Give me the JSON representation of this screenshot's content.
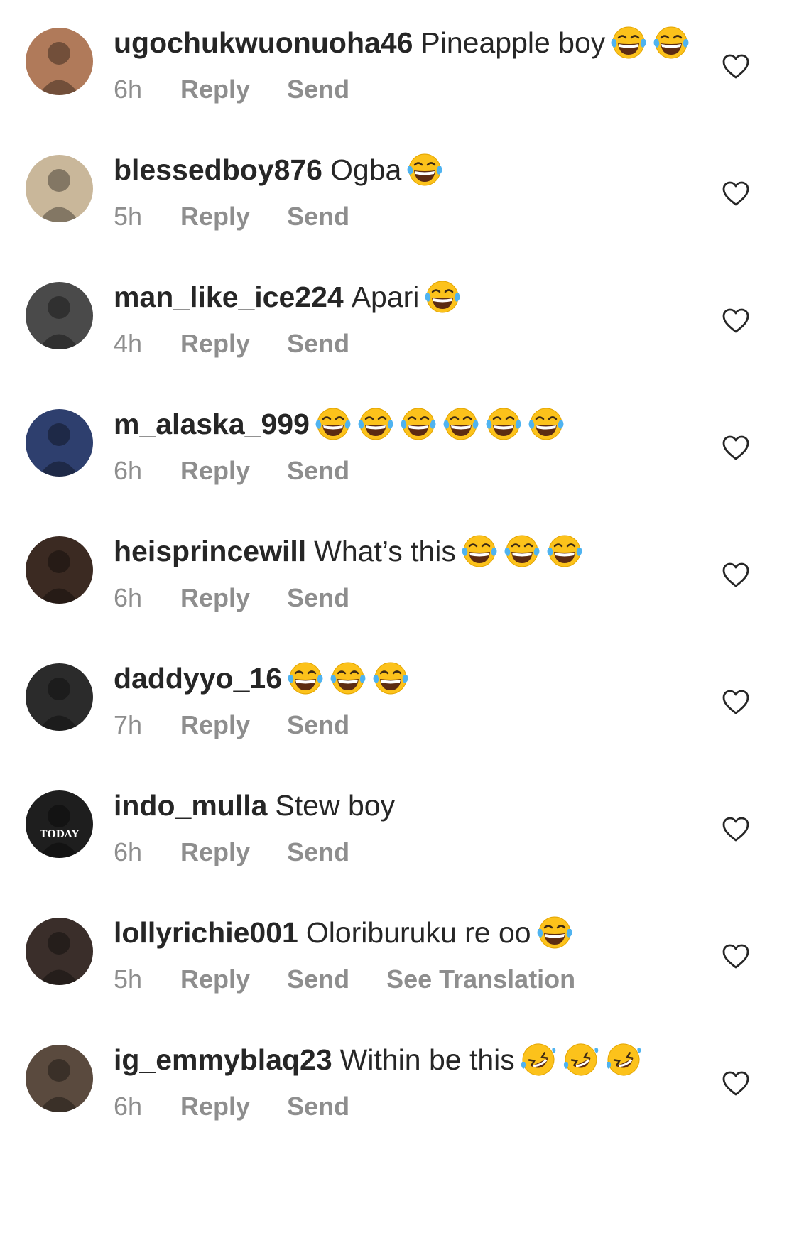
{
  "colors": {
    "text": "#262626",
    "meta": "#8e8e8e",
    "icon": "#262626"
  },
  "comments": [
    {
      "username": "ugochukwuonuoha46",
      "text": "Pineapple boy",
      "emojis": [
        "tears-of-joy",
        "tears-of-joy"
      ],
      "time": "6h",
      "reply": "Reply",
      "send": "Send",
      "translation": "",
      "avatar_color": "#b07a5a"
    },
    {
      "username": "blessedboy876",
      "text": "Ogba",
      "emojis": [
        "tears-of-joy"
      ],
      "time": "5h",
      "reply": "Reply",
      "send": "Send",
      "translation": "",
      "avatar_color": "#c9b79a"
    },
    {
      "username": "man_like_ice224",
      "text": "Apari",
      "emojis": [
        "tears-of-joy"
      ],
      "time": "4h",
      "reply": "Reply",
      "send": "Send",
      "translation": "",
      "avatar_color": "#4a4a4a"
    },
    {
      "username": "m_alaska_999",
      "text": "",
      "emojis": [
        "tears-of-joy",
        "tears-of-joy",
        "tears-of-joy",
        "tears-of-joy",
        "tears-of-joy",
        "tears-of-joy"
      ],
      "time": "6h",
      "reply": "Reply",
      "send": "Send",
      "translation": "",
      "avatar_color": "#2e3f6e"
    },
    {
      "username": "heisprincewill",
      "text": "What’s this",
      "emojis": [
        "tears-of-joy",
        "tears-of-joy",
        "tears-of-joy"
      ],
      "time": "6h",
      "reply": "Reply",
      "send": "Send",
      "translation": "",
      "avatar_color": "#3b2a22"
    },
    {
      "username": "daddyyo_16",
      "text": "",
      "emojis": [
        "tears-of-joy",
        "tears-of-joy",
        "tears-of-joy"
      ],
      "time": "7h",
      "reply": "Reply",
      "send": "Send",
      "translation": "",
      "avatar_color": "#2b2b2b"
    },
    {
      "username": "indo_mulla",
      "text": "Stew boy",
      "emojis": [],
      "time": "6h",
      "reply": "Reply",
      "send": "Send",
      "translation": "",
      "avatar_color": "#1e1e1e",
      "avatar_caption": "TODAY"
    },
    {
      "username": "lollyrichie001",
      "text": "Oloriburuku re oo",
      "emojis": [
        "tears-of-joy"
      ],
      "time": "5h",
      "reply": "Reply",
      "send": "Send",
      "translation": "See Translation",
      "avatar_color": "#3a2e2a"
    },
    {
      "username": "ig_emmyblaq23",
      "text": "Within be this",
      "emojis": [
        "rofl",
        "rofl",
        "rofl"
      ],
      "time": "6h",
      "reply": "Reply",
      "send": "Send",
      "translation": "",
      "avatar_color": "#5a4a3e"
    }
  ]
}
